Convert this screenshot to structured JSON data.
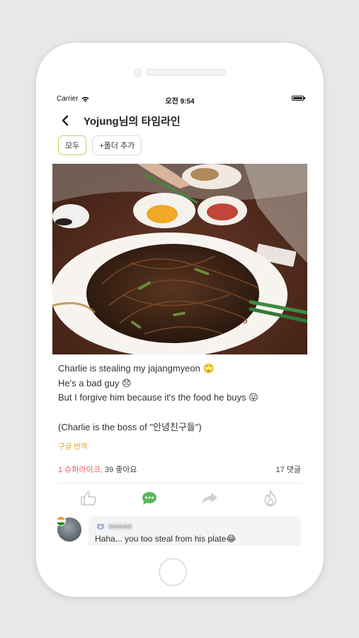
{
  "status_bar": {
    "carrier": "Carrier",
    "time": "오전 9:54"
  },
  "header": {
    "title": "Yojung님의 타임라인"
  },
  "folders": {
    "all_label": "모두",
    "add_label": "+폴더 추가"
  },
  "post": {
    "photo_icon": "jajangmyeon-photo",
    "caption_lines": [
      "Charlie is stealing my jajangmyeon 🙄",
      "He's a bad guy 😞",
      "But I forgive him because it's the food he buys 😛",
      "(Charlie is the boss of \"안녕친구들\")"
    ],
    "translate_label": "구글 번역",
    "superlikes": "1 슈퍼라이크,",
    "likes": " 39 좋아요",
    "comments_count": "17 댓글"
  },
  "actions": [
    {
      "icon": "thumbs-up-icon",
      "active": false
    },
    {
      "icon": "comment-icon",
      "active": true
    },
    {
      "icon": "share-icon",
      "active": false
    },
    {
      "icon": "flame-icon",
      "active": false
    }
  ],
  "comment": {
    "author": "●●●●●",
    "text": "Haha... you too steal from his plate😂"
  },
  "colors": {
    "accent_green": "#5cb85c",
    "superlike_red": "#ef5563",
    "translate_orange": "#e8a830",
    "active_chip_border": "#b7d36a"
  }
}
